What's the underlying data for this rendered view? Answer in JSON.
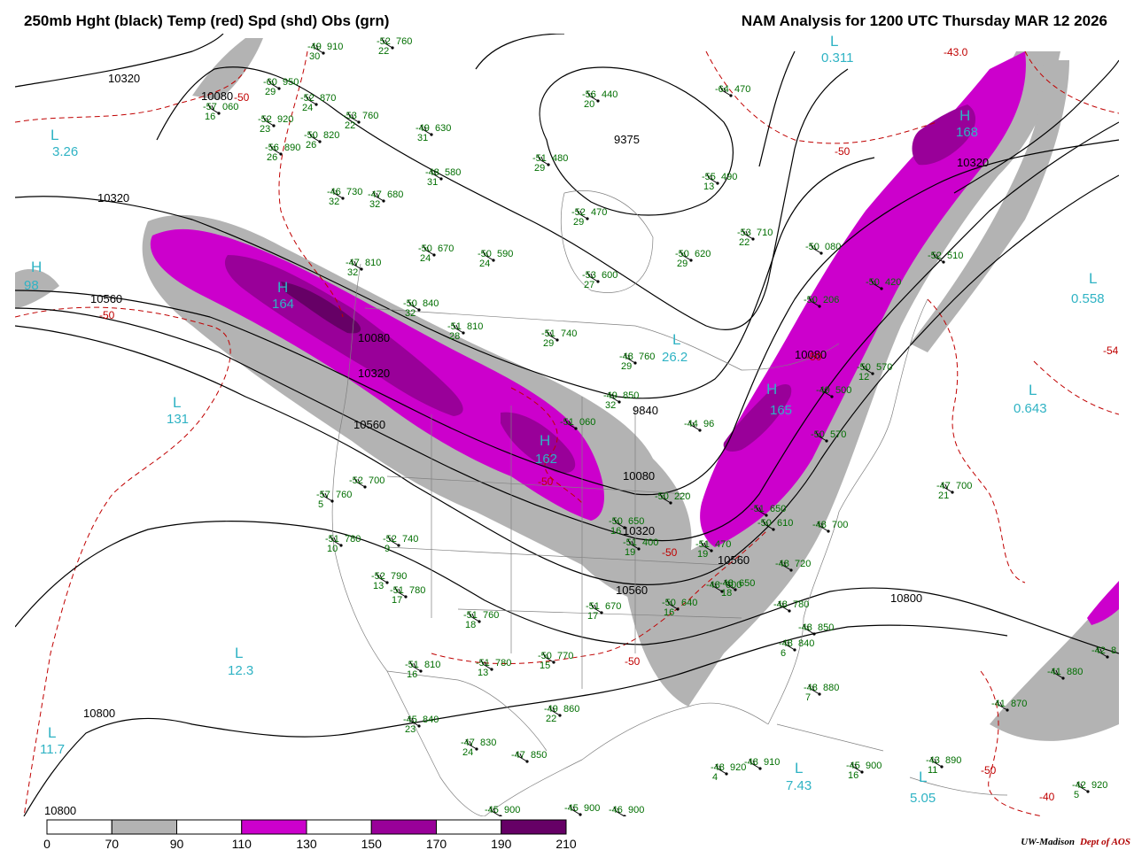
{
  "title_left": "250mb Hght (black) Temp (red) Spd (shd) Obs (grn)",
  "title_right": "NAM Analysis for 1200 UTC Thursday  MAR 12 2026",
  "credit": {
    "org": "UW-Madison",
    "dept": "Dept of AOS"
  },
  "colors": {
    "speed_70_90": "#b3b3b3",
    "speed_110_130": "#cc00cc",
    "speed_150_170": "#990099",
    "speed_190_210": "#660066",
    "height_contour": "#000000",
    "temp_contour": "#c00000",
    "obs": "#006e00",
    "center_label": "#2fb3c4"
  },
  "legend": {
    "ticks": [
      "0",
      "70",
      "90",
      "110",
      "130",
      "150",
      "170",
      "190",
      "210"
    ],
    "colors": [
      "#ffffff",
      "#b3b3b3",
      "#ffffff",
      "#cc00cc",
      "#ffffff",
      "#990099",
      "#ffffff",
      "#660066"
    ]
  },
  "height_labels": [
    "10320",
    "10080",
    "10320",
    "10560",
    "10080",
    "10320",
    "10560",
    "9375",
    "9840",
    "10080",
    "10320",
    "10560",
    "10560",
    "10800",
    "10800",
    "10800",
    "10080",
    "10320"
  ],
  "temp_labels": [
    "-50",
    "-50",
    "-50",
    "-43.0",
    "-50",
    "-54.",
    "-50",
    "-50",
    "-40",
    "-50",
    "-50"
  ],
  "centers": [
    {
      "letter": "L",
      "value": "3.26"
    },
    {
      "letter": "H",
      "value": "164"
    },
    {
      "letter": "L",
      "value": "131"
    },
    {
      "letter": "H",
      "value": "162"
    },
    {
      "letter": "L",
      "value": "12.3"
    },
    {
      "letter": "L",
      "value": "11.7"
    },
    {
      "letter": "L",
      "value": "26.2"
    },
    {
      "letter": "H",
      "value": "168"
    },
    {
      "letter": "L",
      "value": "0.558"
    },
    {
      "letter": "L",
      "value": "0.643"
    },
    {
      "letter": "L",
      "value": "7.43"
    },
    {
      "letter": "L",
      "value": "5.05"
    },
    {
      "letter": "H",
      "value": "98"
    },
    {
      "letter": "H",
      "value": "165"
    },
    {
      "letter": "L",
      "value": "0.311"
    }
  ],
  "observations": [
    {
      "t": "-49",
      "h": "910",
      "s": "30"
    },
    {
      "t": "-52",
      "h": "760",
      "s": "22"
    },
    {
      "t": "-60",
      "h": "950",
      "s": "29"
    },
    {
      "t": "-57",
      "h": "060",
      "s": "16"
    },
    {
      "t": "-52",
      "h": "870",
      "s": "24"
    },
    {
      "t": "-52",
      "h": "920",
      "s": "23"
    },
    {
      "t": "-53",
      "h": "760",
      "s": "22"
    },
    {
      "t": "-56",
      "h": "890",
      "s": "26"
    },
    {
      "t": "-50",
      "h": "820",
      "s": "26"
    },
    {
      "t": "-49",
      "h": "630",
      "s": "31"
    },
    {
      "t": "-56",
      "h": "440",
      "s": "20"
    },
    {
      "t": "-64",
      "h": "470",
      "s": ""
    },
    {
      "t": "-51",
      "h": "480",
      "s": "29"
    },
    {
      "t": "-48",
      "h": "580",
      "s": "31"
    },
    {
      "t": "-46",
      "h": "730",
      "s": "32"
    },
    {
      "t": "-47",
      "h": "680",
      "s": "32"
    },
    {
      "t": "-55",
      "h": "490",
      "s": "13"
    },
    {
      "t": "-52",
      "h": "470",
      "s": "29"
    },
    {
      "t": "-53",
      "h": "710",
      "s": "22"
    },
    {
      "t": "-50",
      "h": "670",
      "s": "24"
    },
    {
      "t": "-50",
      "h": "590",
      "s": "24"
    },
    {
      "t": "-50",
      "h": "620",
      "s": "29"
    },
    {
      "t": "-47",
      "h": "810",
      "s": "32"
    },
    {
      "t": "-53",
      "h": "600",
      "s": "27"
    },
    {
      "t": "-50",
      "h": "840",
      "s": "32"
    },
    {
      "t": "-51",
      "h": "810",
      "s": "28"
    },
    {
      "t": "-51",
      "h": "740",
      "s": "29"
    },
    {
      "t": "-48",
      "h": "760",
      "s": "29"
    },
    {
      "t": "-49",
      "h": "850",
      "s": "32"
    },
    {
      "t": "-51",
      "h": "060",
      "s": ""
    },
    {
      "t": "-52",
      "h": "700",
      "s": ""
    },
    {
      "t": "-57",
      "h": "760",
      "s": "5"
    },
    {
      "t": "-51",
      "h": "780",
      "s": "10"
    },
    {
      "t": "-52",
      "h": "740",
      "s": "9"
    },
    {
      "t": "-52",
      "h": "790",
      "s": "13"
    },
    {
      "t": "-51",
      "h": "780",
      "s": "17"
    },
    {
      "t": "-50",
      "h": "220",
      "s": ""
    },
    {
      "t": "-51",
      "h": "400",
      "s": "19"
    },
    {
      "t": "-51",
      "h": "470",
      "s": "19"
    },
    {
      "t": "-48",
      "h": "600",
      "s": ""
    },
    {
      "t": "-50",
      "h": "640",
      "s": "16"
    },
    {
      "t": "-51",
      "h": "670",
      "s": "17"
    },
    {
      "t": "-51",
      "h": "760",
      "s": "18"
    },
    {
      "t": "-51",
      "h": "810",
      "s": "16"
    },
    {
      "t": "-51",
      "h": "780",
      "s": "13"
    },
    {
      "t": "-50",
      "h": "770",
      "s": "15"
    },
    {
      "t": "-48",
      "h": "720",
      "s": ""
    },
    {
      "t": "-48",
      "h": "780",
      "s": ""
    },
    {
      "t": "-48",
      "h": "850",
      "s": ""
    },
    {
      "t": "-48",
      "h": "840",
      "s": "6"
    },
    {
      "t": "-48",
      "h": "880",
      "s": "7"
    },
    {
      "t": "-49",
      "h": "860",
      "s": "22"
    },
    {
      "t": "-45",
      "h": "840",
      "s": "23"
    },
    {
      "t": "-47",
      "h": "830",
      "s": "24"
    },
    {
      "t": "-47",
      "h": "850",
      "s": ""
    },
    {
      "t": "-48",
      "h": "920",
      "s": "4"
    },
    {
      "t": "-48",
      "h": "910",
      "s": ""
    },
    {
      "t": "-45",
      "h": "900",
      "s": "16"
    },
    {
      "t": "-43",
      "h": "890",
      "s": "11"
    },
    {
      "t": "-47",
      "h": "700",
      "s": "21"
    },
    {
      "t": "-52",
      "h": "510",
      "s": ""
    },
    {
      "t": "-50",
      "h": "570",
      "s": "12"
    },
    {
      "t": "-41",
      "h": "880",
      "s": ""
    },
    {
      "t": "-41",
      "h": "870",
      "s": ""
    },
    {
      "t": "-42",
      "h": "920",
      "s": "5"
    },
    {
      "t": "-42",
      "h": "8",
      "s": ""
    },
    {
      "t": "-45",
      "h": "900",
      "s": ""
    },
    {
      "t": "-45",
      "h": "900",
      "s": ""
    },
    {
      "t": "-46",
      "h": "900",
      "s": ""
    },
    {
      "t": "-50",
      "h": "650",
      "s": "16"
    },
    {
      "t": "-48",
      "h": "650",
      "s": "18"
    },
    {
      "t": "-51",
      "h": "650",
      "s": ""
    },
    {
      "t": "-50",
      "h": "610",
      "s": ""
    },
    {
      "t": "-48",
      "h": "700",
      "s": ""
    },
    {
      "t": "-50",
      "h": "570",
      "s": ""
    },
    {
      "t": "-49",
      "h": "500",
      "s": ""
    },
    {
      "t": "-44",
      "h": "96",
      "s": ""
    },
    {
      "t": "-50",
      "h": "420",
      "s": ""
    },
    {
      "t": "-50",
      "h": "080",
      "s": ""
    },
    {
      "t": "-50",
      "h": "206",
      "s": ""
    }
  ]
}
